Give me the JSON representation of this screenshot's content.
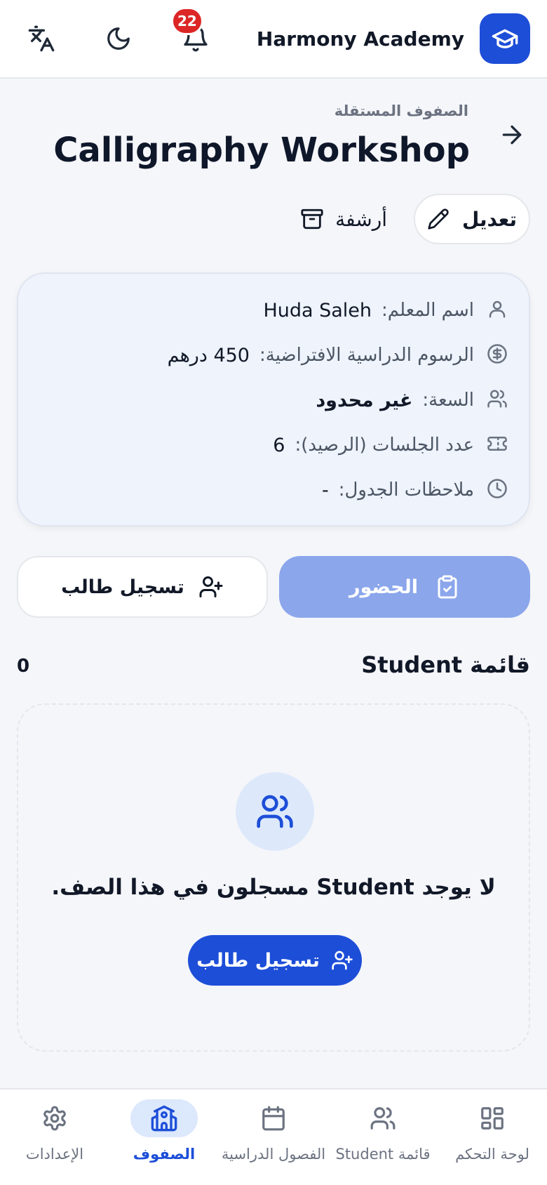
{
  "header": {
    "app_name": "Harmony Academy",
    "notification_count": "22",
    "accent": "#1d4ed8"
  },
  "page": {
    "breadcrumb": "الصفوف المستقلة",
    "title": "Calligraphy Workshop",
    "edit_label": "تعديل",
    "archive_label": "أرشفة"
  },
  "info": {
    "teacher_label": "اسم المعلم:",
    "teacher_value": "Huda Saleh",
    "fee_label": "الرسوم الدراسية الافتراضية:",
    "fee_value": "450 درهم",
    "capacity_label": "السعة:",
    "capacity_value": "غير محدود",
    "sessions_label": "عدد الجلسات (الرصيد):",
    "sessions_value": "6",
    "schedule_label": "ملاحظات الجدول:",
    "schedule_value": "-"
  },
  "actions": {
    "attendance_label": "الحضور",
    "enroll_label": "تسجيل طالب"
  },
  "students": {
    "title": "قائمة Student",
    "count": "0",
    "empty_message": "لا يوجد Student مسجلون في هذا الصف.",
    "enroll_label": "تسجيل طالب"
  },
  "nav": {
    "items": [
      {
        "label": "لوحة التحكم",
        "icon": "dashboard-icon",
        "active": false
      },
      {
        "label": "قائمة Student",
        "icon": "users-icon",
        "active": false
      },
      {
        "label": "الفصول الدراسية",
        "icon": "calendar-icon",
        "active": false
      },
      {
        "label": "الصفوف",
        "icon": "school-icon",
        "active": true
      },
      {
        "label": "الإعدادات",
        "icon": "gear-icon",
        "active": false
      }
    ]
  }
}
